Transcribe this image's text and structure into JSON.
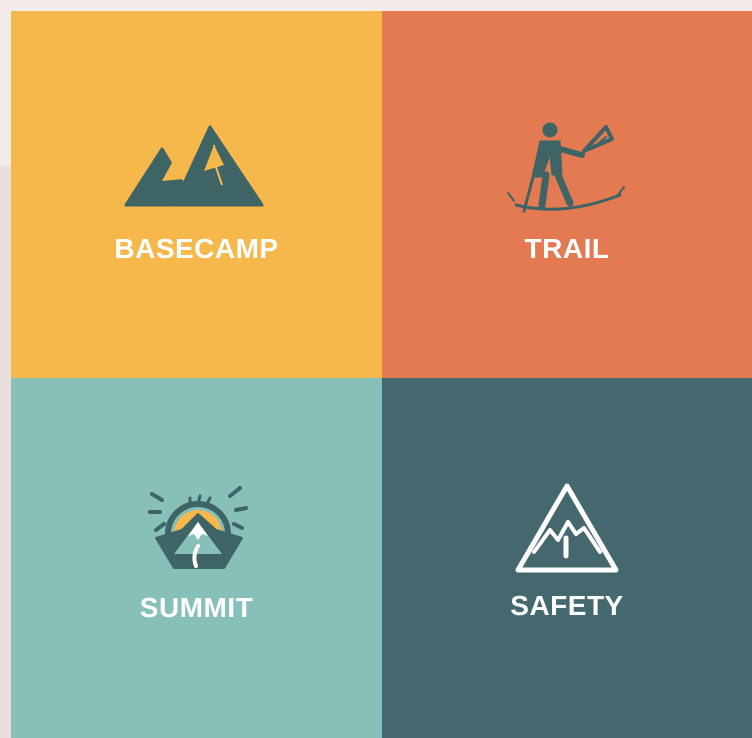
{
  "tiles": [
    {
      "label": "BASECAMP",
      "color": "#f7b84b",
      "icon": "mountain-peaks-icon"
    },
    {
      "label": "TRAIL",
      "color": "#e47a52",
      "icon": "hiker-icon"
    },
    {
      "label": "SUMMIT",
      "color": "#86c0b9",
      "icon": "sun-summit-badge-icon"
    },
    {
      "label": "SAFETY",
      "color": "#44686e",
      "icon": "warning-triangle-icon"
    }
  ],
  "icon_color": "#3e6466",
  "accent_color": "#f7b84b"
}
